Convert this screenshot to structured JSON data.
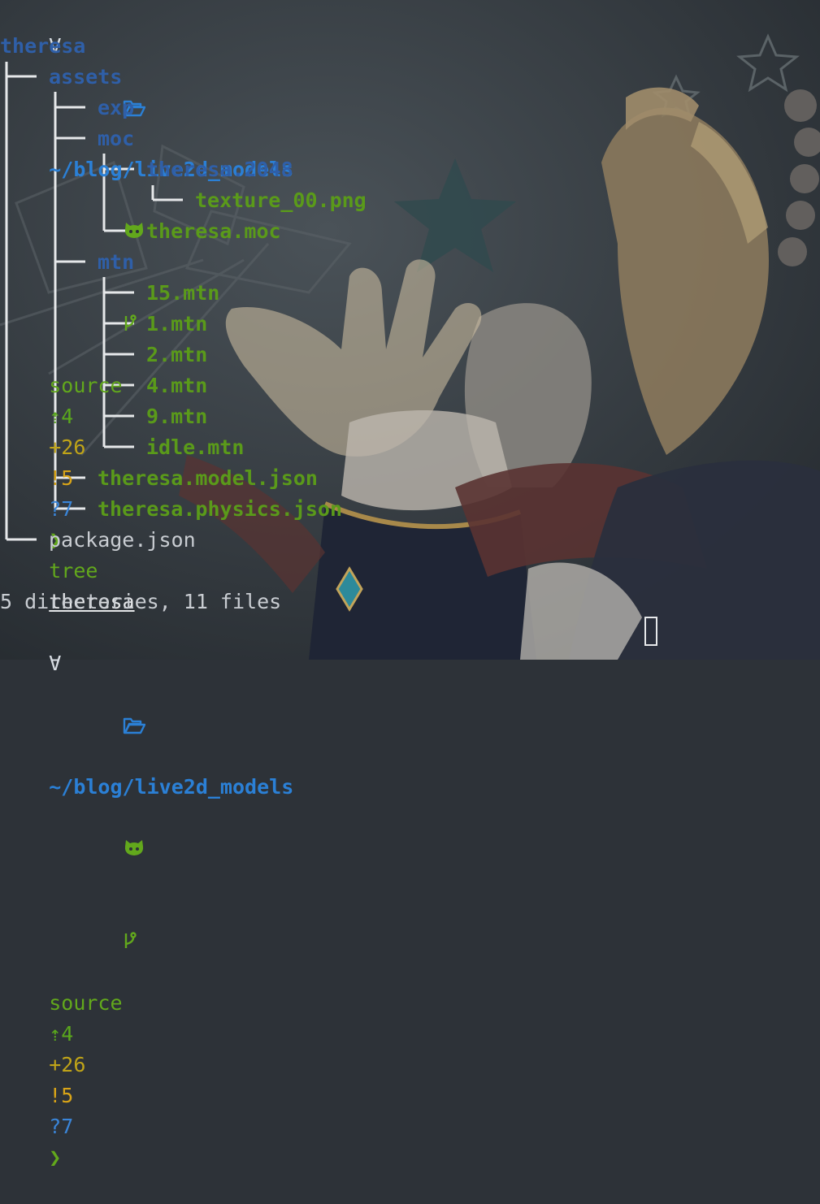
{
  "prompt": {
    "arrow": "Ɐ",
    "folder_icon": "folder-open-icon",
    "path": "~/blog/live2d_models",
    "git_icon": "github-cat-icon",
    "branch_icon": "git-branch-icon",
    "branch": "source",
    "ahead": "⇡4",
    "staged": "+26",
    "modified": "!5",
    "untracked": "?7",
    "chevron": "❯"
  },
  "command": {
    "name": "tree",
    "arg": "theresa"
  },
  "tree": {
    "root": "theresa",
    "assets": "assets",
    "exp": "exp",
    "moc": "moc",
    "theresa_2048": "theresa.2048",
    "texture": "texture_00.png",
    "theresa_moc": "theresa.moc",
    "mtn": "mtn",
    "mtn_15": "15.mtn",
    "mtn_1": "1.mtn",
    "mtn_2": "2.mtn",
    "mtn_4": "4.mtn",
    "mtn_9": "9.mtn",
    "mtn_idle": "idle.mtn",
    "model_json": "theresa.model.json",
    "physics_json": "theresa.physics.json",
    "package_json": "package.json"
  },
  "summary": "5 directories, 11 files",
  "colors": {
    "directory": "#2f5fa8",
    "file": "#5a9a1a",
    "path": "#2b80d6",
    "git_branch": "#62a81c",
    "git_staged": "#c0a418",
    "git_untracked": "#3a85d8"
  }
}
